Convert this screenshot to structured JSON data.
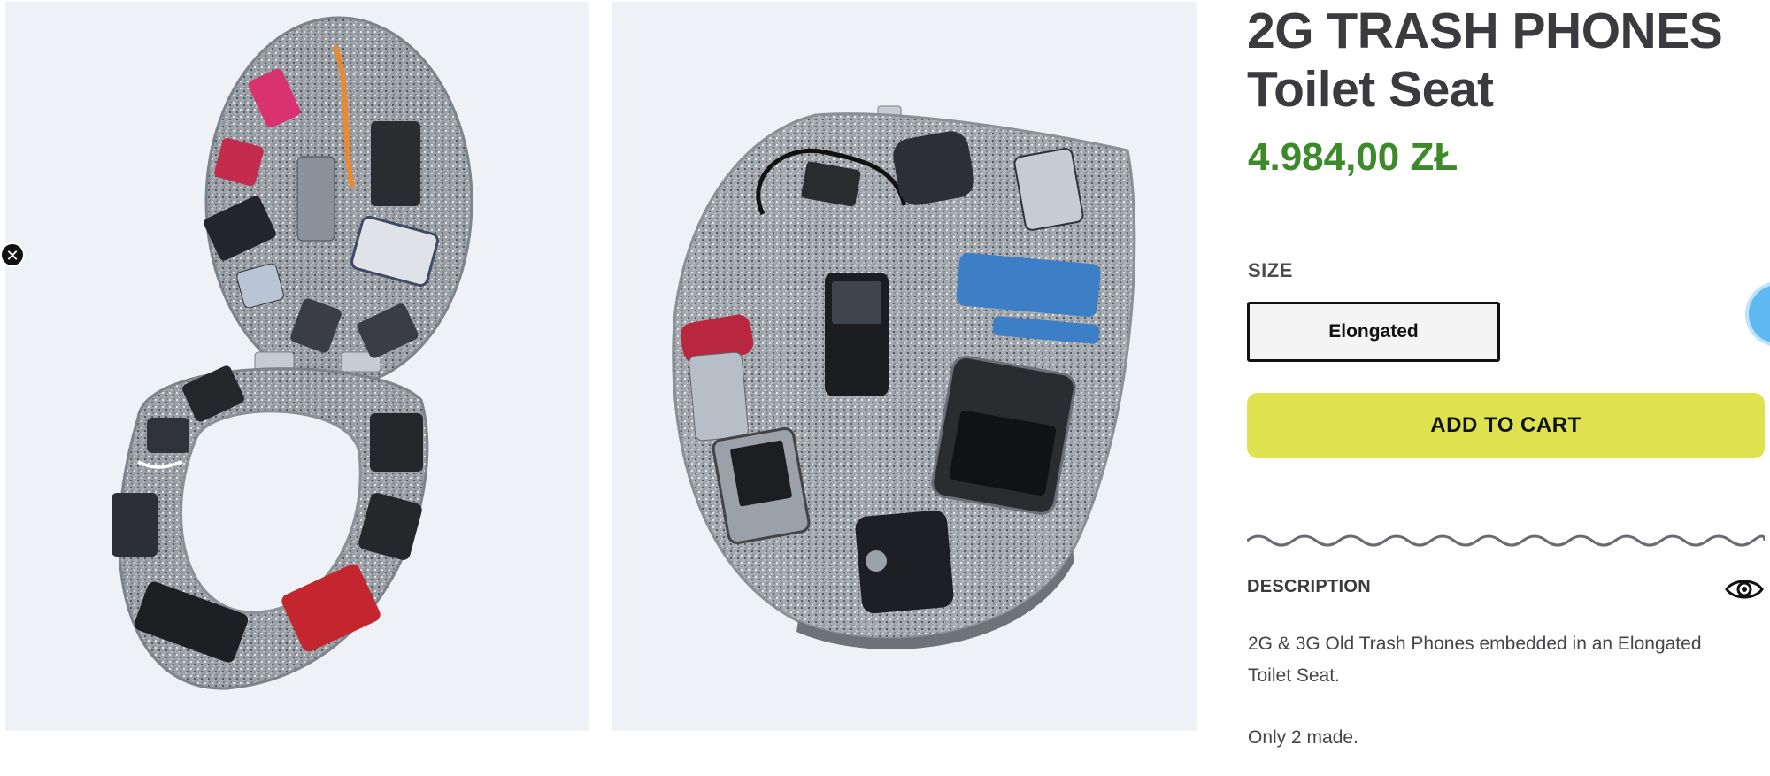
{
  "product": {
    "title_line1": "2G TRASH PHONES",
    "title_line2": "Toilet Seat",
    "price": "4.984,00 ZŁ"
  },
  "size": {
    "label": "SIZE",
    "selected": "Elongated"
  },
  "actions": {
    "add_to_cart": "ADD TO CART"
  },
  "description": {
    "heading": "DESCRIPTION",
    "paragraphs": [
      "2G & 3G Old Trash Phones embedded in an Elongated Toilet Seat.",
      "Only 2 made."
    ]
  },
  "icons": {
    "close": "close-icon",
    "eye": "eye-icon",
    "chat": "chat-icon"
  },
  "colors": {
    "price": "#3c8a29",
    "cta": "#dfe24f",
    "photo_bg": "#eef1f6",
    "chat": "#5fb8ef"
  }
}
